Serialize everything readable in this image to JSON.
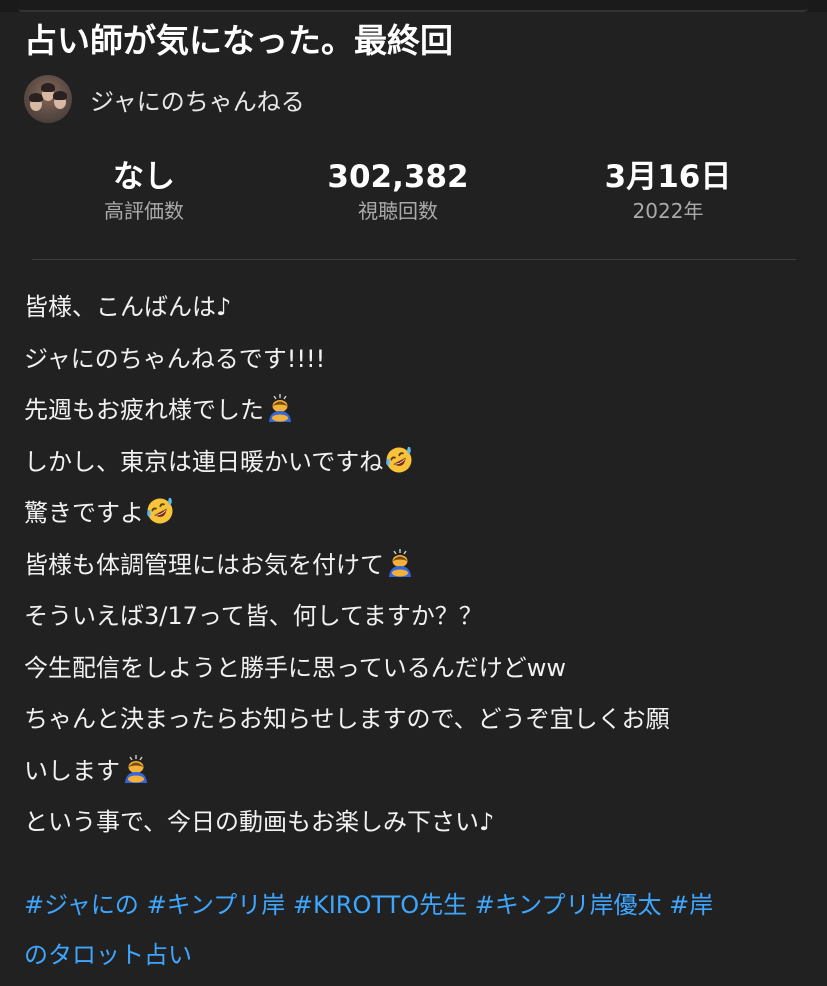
{
  "video": {
    "title": "占い師が気になった。最終回",
    "channel_name": "ジャにのちゃんねる"
  },
  "stats": {
    "likes_value": "なし",
    "likes_label": "高評価数",
    "views_value": "302,382",
    "views_label": "視聴回数",
    "date_value": "3月16日",
    "date_label": "2022年"
  },
  "description": {
    "lines": [
      {
        "text": "皆様、こんばんは♪",
        "emoji": ""
      },
      {
        "text": "ジャにのちゃんねるです!!!!",
        "emoji": ""
      },
      {
        "text": "先週もお疲れ様でした",
        "emoji": "bowing-person-emoji"
      },
      {
        "text": "しかし、東京は連日暖かいですね",
        "emoji": "rofl-emoji"
      },
      {
        "text": "驚きですよ",
        "emoji": "rofl-emoji"
      },
      {
        "text": "皆様も体調管理にはお気を付けて",
        "emoji": "bowing-person-emoji"
      },
      {
        "text": "そういえば3/17って皆、何してますか？？",
        "emoji": ""
      },
      {
        "text": "今生配信をしようと勝手に思っているんだけどww",
        "emoji": ""
      },
      {
        "text": "ちゃんと決まったらお知らせしますので、どうぞ宜しくお願",
        "emoji": ""
      },
      {
        "text": "いします",
        "emoji": "bowing-person-emoji"
      },
      {
        "text": "という事で、今日の動画もお楽しみ下さい♪",
        "emoji": ""
      }
    ]
  },
  "hashtags": {
    "line1": [
      "#ジャにの",
      "#キンプリ岸",
      "#KIROTTO先生",
      "#キンプリ岸優太",
      "#岸"
    ],
    "line2": [
      "のタロット占い"
    ]
  },
  "colors": {
    "background": "#212121",
    "text": "#f1f1f1",
    "muted": "#aaaaaa",
    "link": "#3ea6ff"
  }
}
